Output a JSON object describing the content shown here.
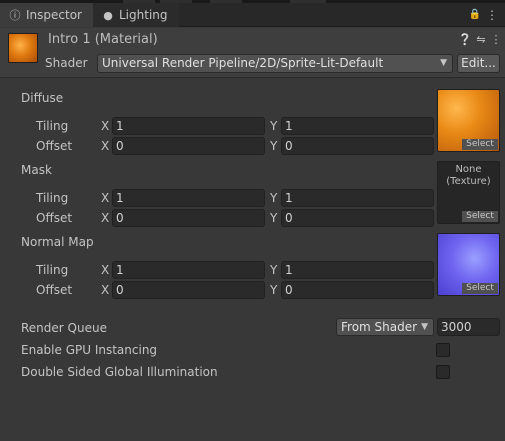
{
  "tabs": [
    {
      "label": "Inspector",
      "icon": "info-icon"
    },
    {
      "label": "Lighting",
      "icon": "bulb-icon"
    }
  ],
  "material": {
    "title": "Intro 1 (Material)"
  },
  "shader": {
    "label": "Shader",
    "value": "Universal Render Pipeline/2D/Sprite-Lit-Default",
    "edit_label": "Edit..."
  },
  "sections": [
    {
      "label": "Diffuse",
      "tiling_label": "Tiling",
      "offset_label": "Offset",
      "tiling": {
        "x": "1",
        "y": "1"
      },
      "offset": {
        "x": "0",
        "y": "0"
      },
      "texture": {
        "select": "Select"
      }
    },
    {
      "label": "Mask",
      "tiling_label": "Tiling",
      "offset_label": "Offset",
      "tiling": {
        "x": "1",
        "y": "1"
      },
      "offset": {
        "x": "0",
        "y": "0"
      },
      "texture": {
        "none": "None",
        "kind": "(Texture)",
        "select": "Select"
      }
    },
    {
      "label": "Normal Map",
      "tiling_label": "Tiling",
      "offset_label": "Offset",
      "tiling": {
        "x": "1",
        "y": "1"
      },
      "offset": {
        "x": "0",
        "y": "0"
      },
      "texture": {
        "select": "Select"
      }
    }
  ],
  "axis": {
    "x": "X",
    "y": "Y"
  },
  "render_queue": {
    "label": "Render Queue",
    "mode": "From Shader",
    "value": "3000"
  },
  "gpu_instancing": {
    "label": "Enable GPU Instancing",
    "checked": false
  },
  "double_sided_gi": {
    "label": "Double Sided Global Illumination",
    "checked": false
  },
  "colors": {
    "panel_bg": "#383838",
    "field_bg": "#2a2a2a",
    "tab_active": "#3c3c3c",
    "text": "#c4c4c4"
  }
}
